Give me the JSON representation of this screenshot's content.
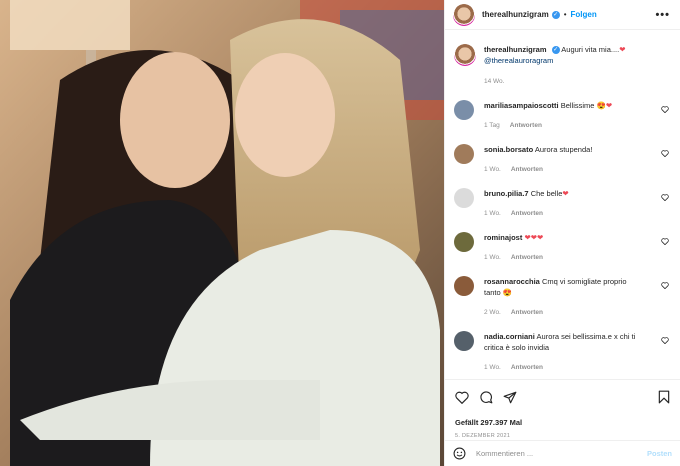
{
  "header": {
    "username": "therealhunzigram",
    "separator": "•",
    "follow_label": "Folgen",
    "more_label": "•••"
  },
  "caption": {
    "username": "therealhunzigram",
    "text": "Auguri vita mia....",
    "mention": "@therealauroragram",
    "age": "14 Wo."
  },
  "comments": [
    {
      "user": "mariliasampaioscotti",
      "text": "Bellissime 😍",
      "heart": true,
      "age": "1 Tag",
      "reply": "Antworten",
      "avatar_color": "#7a8ea8"
    },
    {
      "user": "sonia.borsato",
      "text": "Aurora stupenda!",
      "heart": false,
      "age": "1 Wo.",
      "reply": "Antworten",
      "avatar_color": "#a07b5b"
    },
    {
      "user": "bruno.pilia.7",
      "text": "Che belle",
      "heart": true,
      "age": "1 Wo.",
      "reply": "Antworten",
      "avatar_color": "#dbdbdb"
    },
    {
      "user": "rominajost",
      "text": "",
      "hearts": "❤❤❤",
      "age": "1 Wo.",
      "reply": "Antworten",
      "avatar_color": "#6d6a3c"
    },
    {
      "user": "rosannarocchia",
      "text": "Cmq vi somigliate proprio tanto 😍",
      "heart": false,
      "age": "2 Wo.",
      "reply": "Antworten",
      "avatar_color": "#8a5b3a"
    },
    {
      "user": "nadia.corniani",
      "text": "Aurora sei bellissima.e x chi ti critica è solo invidia",
      "heart": false,
      "age": "1 Wo.",
      "reply": "Antworten",
      "avatar_color": "#55606a"
    }
  ],
  "actions": {
    "icons": [
      "heart-icon",
      "comment-icon",
      "share-icon",
      "bookmark-icon"
    ],
    "likes": "Gefällt 297.397 Mal",
    "date": "5. DEZEMBER 2021"
  },
  "add_comment": {
    "placeholder": "Kommentieren ...",
    "post_label": "Posten"
  },
  "colors": {
    "link": "#0095f6",
    "muted": "#8e8e8e",
    "heart": "#ed4956",
    "post_disabled": "#b2dffc"
  }
}
